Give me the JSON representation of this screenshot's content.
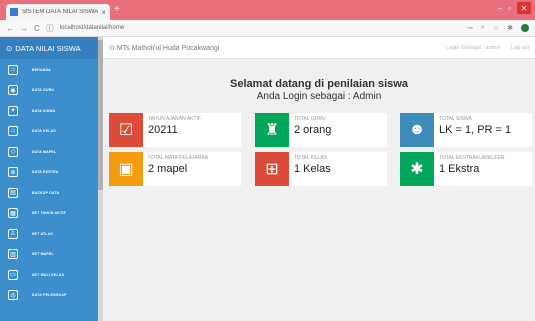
{
  "browser": {
    "tab_title": "SISTEM DATA NILAI SISWA",
    "tab_close": "×",
    "new_tab": "+",
    "url": "localhost/datanilai/home",
    "back": "←",
    "forward": "→",
    "reload": "C",
    "info": "ⓘ",
    "min": "–",
    "max": "▫",
    "close": "✕",
    "icons": {
      "key": "⊸",
      "zoom": "⌕",
      "star": "☆",
      "ext_puzzle": "✱"
    }
  },
  "sidebar": {
    "brand": "DATA NILAI SISWA",
    "brand_icon": "⊙",
    "items": [
      {
        "icon": "⌂",
        "label": "BERANDA"
      },
      {
        "icon": "◉",
        "label": "DATA GURU"
      },
      {
        "icon": "✦",
        "label": "DATA SISWA"
      },
      {
        "icon": "⌂",
        "label": "DATA KELAS"
      },
      {
        "icon": "◇",
        "label": "DATA MAPEL"
      },
      {
        "icon": "⊕",
        "label": "DATA EKSTRA"
      },
      {
        "icon": "▤",
        "label": "BACKUP DATA"
      },
      {
        "icon": "▦",
        "label": "SET TAHUN AKTIF"
      },
      {
        "icon": "♙",
        "label": "SET ATLAS"
      },
      {
        "icon": "▥",
        "label": "SET MAPEL"
      },
      {
        "icon": "▭",
        "label": "SET WALI KELAS"
      },
      {
        "icon": "◎",
        "label": "DATA PELENGKAP"
      }
    ]
  },
  "header": {
    "school_icon": "⊙",
    "school": "MTs Matholi'ul Huda Pucakwangi",
    "login_as": "Login Sebagai : admin",
    "logout": "Log out"
  },
  "welcome": {
    "line1": "Selamat datang di penilaian siswa",
    "line2": "Anda Login sebagai : Admin"
  },
  "cards": [
    {
      "icon": "☑",
      "color": "#dd4b39",
      "label": "TAHUN AJARAN AKTIF",
      "value": "20211"
    },
    {
      "icon": "♜",
      "color": "#00a65a",
      "label": "TOTAL GURU",
      "value": "2 orang"
    },
    {
      "icon": "☻",
      "color": "#3c8dbc",
      "label": "TOTAL SISWA",
      "value": "LK = 1, PR = 1"
    },
    {
      "icon": "▣",
      "color": "#f39c12",
      "label": "TOTAL MATA PELAJARAN",
      "value": "2 mapel"
    },
    {
      "icon": "⊞",
      "color": "#dd4b39",
      "label": "TOTAL KELAS",
      "value": "1 Kelas"
    },
    {
      "icon": "✱",
      "color": "#00a65a",
      "label": "TOTAL EKSTRAKURIKULER",
      "value": "1 Ekstra"
    }
  ]
}
